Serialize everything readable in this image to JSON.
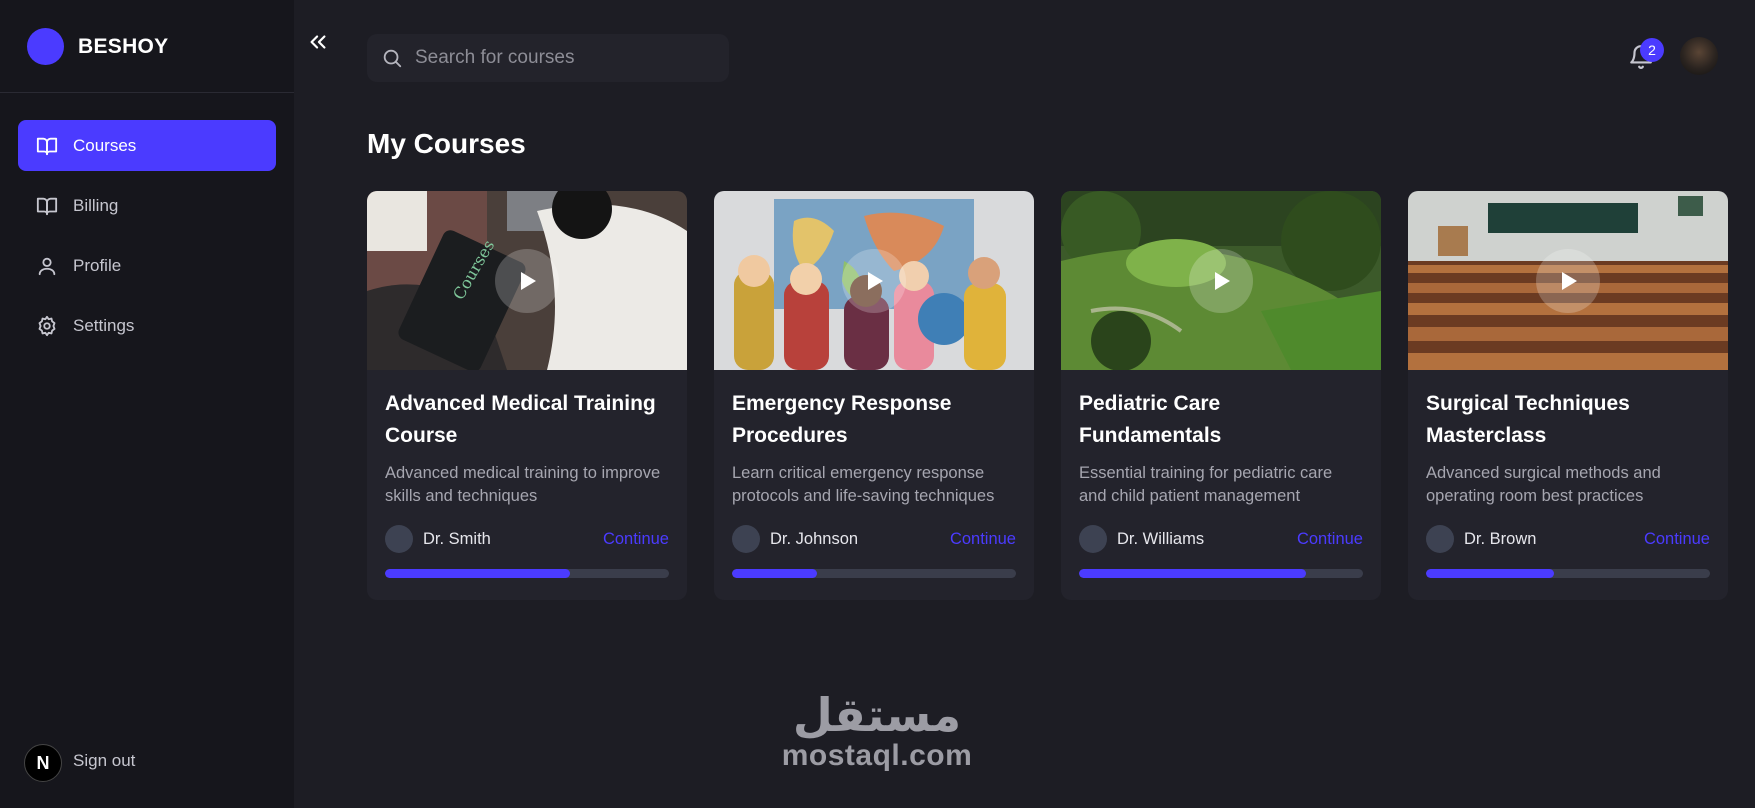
{
  "brand": {
    "name": "BESHOY",
    "accent": "#4b3bff"
  },
  "sidebar": {
    "items": [
      {
        "label": "Courses",
        "icon": "book-open-icon",
        "active": true
      },
      {
        "label": "Billing",
        "icon": "book-open-icon",
        "active": false
      },
      {
        "label": "Profile",
        "icon": "user-icon",
        "active": false
      },
      {
        "label": "Settings",
        "icon": "gear-icon",
        "active": false
      }
    ],
    "signout_label": "Sign out",
    "signout_badge": "N"
  },
  "search": {
    "placeholder": "Search for courses"
  },
  "notifications": {
    "count": "2"
  },
  "page": {
    "title": "My Courses"
  },
  "courses": [
    {
      "title": "Advanced Medical Training Course",
      "description": "Advanced medical training to improve skills and techniques",
      "instructor": "Dr. Smith",
      "action": "Continue",
      "progress": 0.65
    },
    {
      "title": "Emergency Response Procedures",
      "description": "Learn critical emergency response protocols and life-saving techniques",
      "instructor": "Dr. Johnson",
      "action": "Continue",
      "progress": 0.3
    },
    {
      "title": "Pediatric Care Fundamentals",
      "description": "Essential training for pediatric care and child patient management",
      "instructor": "Dr. Williams",
      "action": "Continue",
      "progress": 0.8
    },
    {
      "title": "Surgical Techniques Masterclass",
      "description": "Advanced surgical methods and operating room best practices",
      "instructor": "Dr. Brown",
      "action": "Continue",
      "progress": 0.45
    }
  ],
  "watermark": {
    "arabic": "مستقل",
    "latin": "mostaql.com"
  }
}
